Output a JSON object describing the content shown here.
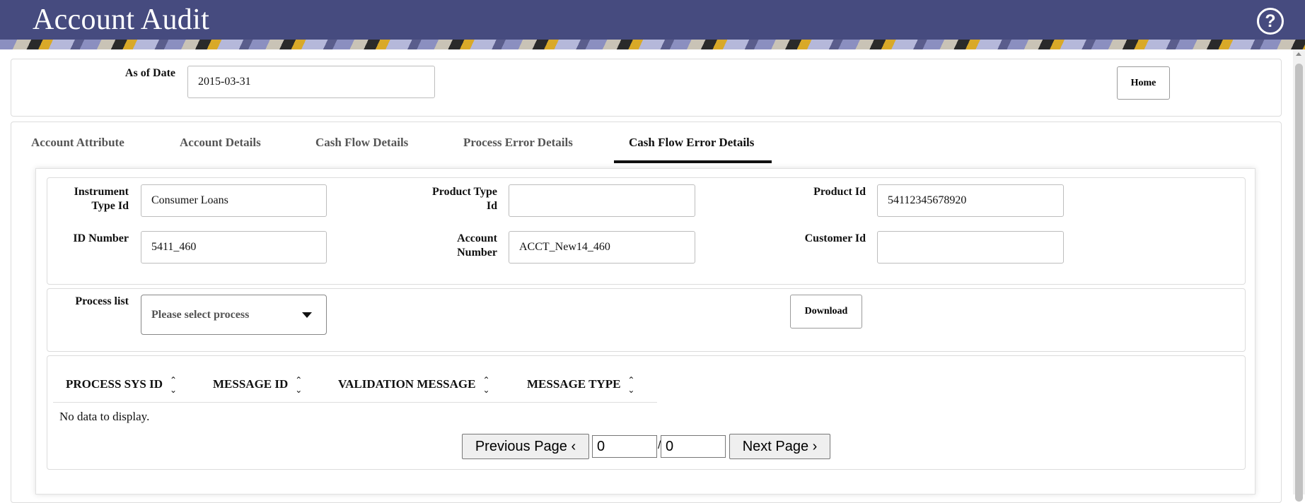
{
  "header": {
    "title": "Account Audit",
    "help_icon": "?"
  },
  "filter": {
    "as_of_date_label": "As of Date",
    "as_of_date_value": "2015-03-31",
    "home_label": "Home"
  },
  "tabs": [
    {
      "label": "Account Attribute"
    },
    {
      "label": "Account Details"
    },
    {
      "label": "Cash Flow Details"
    },
    {
      "label": "Process Error Details"
    },
    {
      "label": "Cash Flow Error Details",
      "active": true
    }
  ],
  "details": {
    "instrument_type_label_1": "Instrument",
    "instrument_type_label_2": "Type Id",
    "instrument_type_value": "Consumer Loans",
    "product_type_label_1": "Product Type",
    "product_type_label_2": "Id",
    "product_type_value": "",
    "product_id_label": "Product Id",
    "product_id_value": "54112345678920",
    "id_number_label": "ID Number",
    "id_number_value": "5411_460",
    "account_number_label_1": "Account",
    "account_number_label_2": "Number",
    "account_number_value": "ACCT_New14_460",
    "customer_id_label": "Customer Id",
    "customer_id_value": ""
  },
  "process": {
    "label": "Process list",
    "placeholder": "Please select process",
    "download_label": "Download"
  },
  "table": {
    "columns": [
      "PROCESS SYS ID",
      "MESSAGE ID",
      "VALIDATION MESSAGE",
      "MESSAGE TYPE"
    ],
    "empty_text": "No data to display."
  },
  "pagination": {
    "prev_label": "Previous Page",
    "next_label": "Next Page",
    "current": "0",
    "total": "0",
    "separator": "/"
  }
}
